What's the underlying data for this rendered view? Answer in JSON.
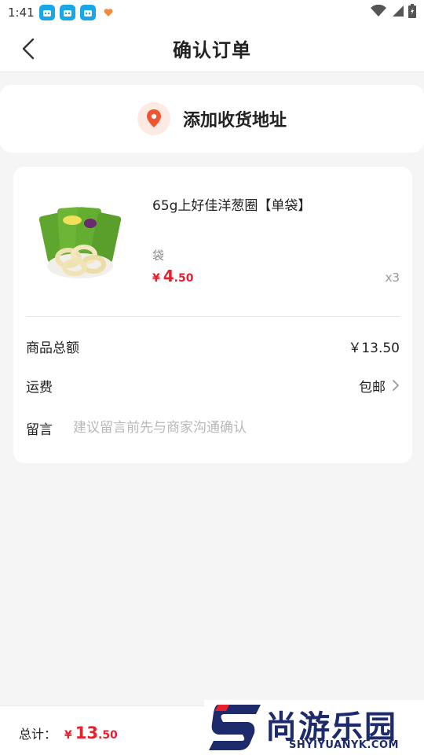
{
  "status_bar": {
    "time": "1:41",
    "app_icons": [
      "app-icon",
      "app-icon",
      "app-icon",
      "heart-app-icon"
    ],
    "right_icons": [
      "wifi-icon",
      "signal-icon",
      "battery-icon"
    ]
  },
  "header": {
    "title": "确认订单"
  },
  "address": {
    "label": "添加收货地址"
  },
  "product": {
    "name": "65g上好佳洋葱圈【单袋】",
    "spec": "袋",
    "price_symbol": "¥",
    "price_int": "4",
    "price_dec": ".50",
    "quantity": "x3"
  },
  "summary": {
    "total_label": "商品总额",
    "total_value": "￥13.50",
    "shipping_label": "运费",
    "shipping_value": "包邮",
    "note_label": "留言",
    "note_placeholder": "建议留言前先与商家沟通确认"
  },
  "bottom": {
    "total_label": "总计：",
    "price_symbol": "¥",
    "price_int": "13",
    "price_dec": ".50"
  },
  "watermark": {
    "text": "尚游乐园",
    "url": "SHYIYUANYK.COM"
  },
  "colors": {
    "accent_red": "#e8202e",
    "pin_orange": "#f2542d",
    "background": "#f5f5f5"
  }
}
